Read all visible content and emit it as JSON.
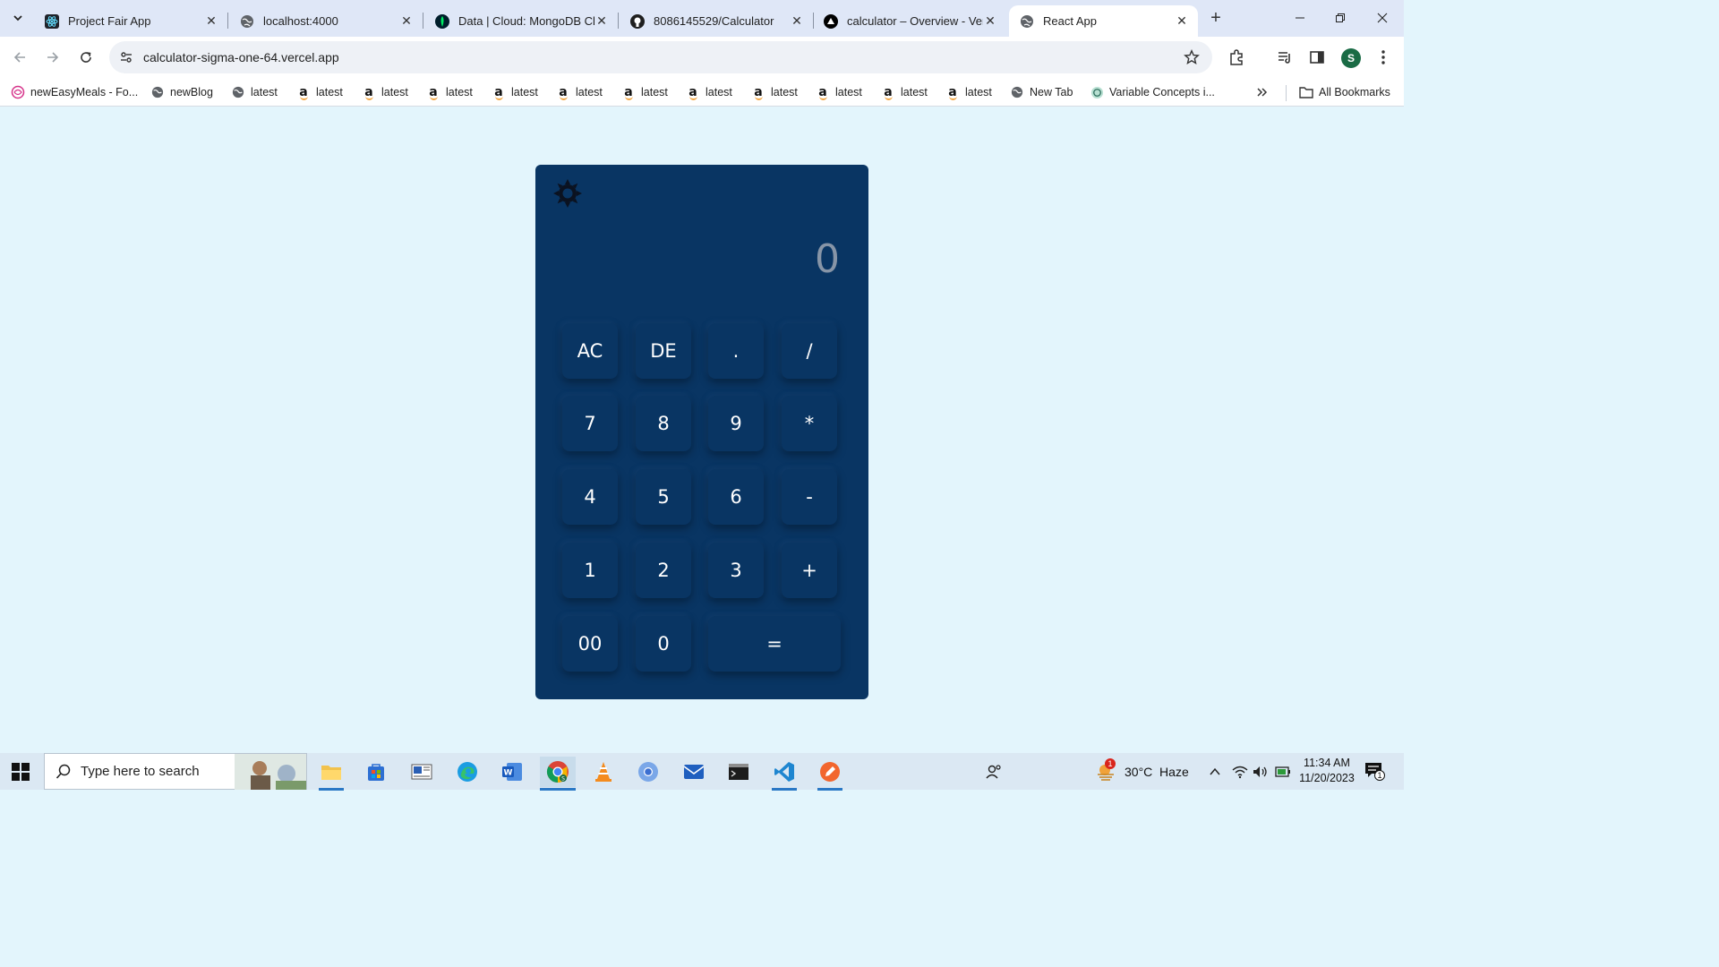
{
  "browser": {
    "tabs": [
      {
        "title": "Project Fair App",
        "icon": "react-icon"
      },
      {
        "title": "localhost:4000",
        "icon": "globe-icon"
      },
      {
        "title": "Data | Cloud: MongoDB Cl",
        "icon": "mongodb-leaf-icon"
      },
      {
        "title": "8086145529/Calculator",
        "icon": "github-icon"
      },
      {
        "title": "calculator – Overview - Ver",
        "icon": "vercel-icon"
      },
      {
        "title": "React App",
        "icon": "globe-icon",
        "active": true
      }
    ],
    "url": "calculator-sigma-one-64.vercel.app",
    "profile_initial": "S",
    "bookmarks": [
      {
        "label": "newEasyMeals - Fo...",
        "icon": "easymeals-icon"
      },
      {
        "label": "newBlog",
        "icon": "globe-icon"
      },
      {
        "label": "latest",
        "icon": "globe-icon"
      },
      {
        "label": "latest",
        "icon": "amazon-icon"
      },
      {
        "label": "latest",
        "icon": "amazon-icon"
      },
      {
        "label": "latest",
        "icon": "amazon-icon"
      },
      {
        "label": "latest",
        "icon": "amazon-icon"
      },
      {
        "label": "latest",
        "icon": "amazon-icon"
      },
      {
        "label": "latest",
        "icon": "amazon-icon"
      },
      {
        "label": "latest",
        "icon": "amazon-icon"
      },
      {
        "label": "latest",
        "icon": "amazon-icon"
      },
      {
        "label": "latest",
        "icon": "amazon-icon"
      },
      {
        "label": "latest",
        "icon": "amazon-icon"
      },
      {
        "label": "latest",
        "icon": "amazon-icon"
      },
      {
        "label": "New Tab",
        "icon": "globe-icon"
      },
      {
        "label": "Variable Concepts i...",
        "icon": "openai-icon"
      }
    ],
    "all_bookmarks_label": "All Bookmarks"
  },
  "calculator": {
    "display_value": "0",
    "keys": [
      [
        "AC",
        "DE",
        ".",
        "/"
      ],
      [
        "7",
        "8",
        "9",
        "*"
      ],
      [
        "4",
        "5",
        "6",
        "-"
      ],
      [
        "1",
        "2",
        "3",
        "+"
      ],
      [
        "00",
        "0",
        "="
      ]
    ]
  },
  "taskbar": {
    "search_placeholder": "Type here to search",
    "weather": "30°C  Haze",
    "weather_badge": "1",
    "time": "11:34 AM",
    "date": "11/20/2023",
    "notification_count": "1"
  },
  "colors": {
    "page_bg": "#e3f5fc",
    "calc_bg": "#093563",
    "display_text": "#8795a7",
    "key_text": "#ffffff"
  }
}
